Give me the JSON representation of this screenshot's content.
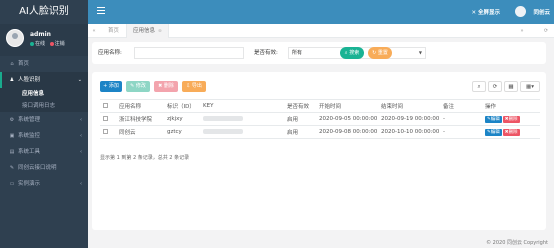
{
  "brand": "AI人脸识别",
  "user": {
    "name": "admin",
    "online": "在线",
    "logout": "注销"
  },
  "nav": [
    {
      "label": "首页",
      "icon": "home-icon",
      "glyph": "⌂"
    },
    {
      "label": "人脸识别",
      "icon": "user-icon",
      "glyph": "♟",
      "open": true,
      "children": [
        {
          "label": "应用信息",
          "active": true
        },
        {
          "label": "接口调用日志"
        }
      ]
    },
    {
      "label": "系统管理",
      "icon": "gear-icon",
      "glyph": "⚙"
    },
    {
      "label": "系统监控",
      "icon": "monitor-icon",
      "glyph": "▣"
    },
    {
      "label": "系统工具",
      "icon": "tools-icon",
      "glyph": "▤"
    },
    {
      "label": "同创云接口说明",
      "icon": "doc-icon",
      "glyph": "✎"
    },
    {
      "label": "实例演示",
      "icon": "desktop-icon",
      "glyph": "▭"
    }
  ],
  "topbar": {
    "fullscreen": "全屏显示",
    "username": "同创云"
  },
  "tabs": {
    "home": "首页",
    "current": "应用信息"
  },
  "search": {
    "app_name_label": "应用名称:",
    "app_name_value": "",
    "valid_label": "是否有效:",
    "valid_value": "所有",
    "search_btn": "搜索",
    "reset_btn": "重置"
  },
  "toolbar": {
    "add": "添加",
    "edit": "修改",
    "delete": "删除",
    "export": "导出"
  },
  "table": {
    "headers": [
      "应用名称",
      "标识（ID）",
      "KEY",
      "是否有效",
      "开始时间",
      "结束时间",
      "备注",
      "操作"
    ],
    "rows": [
      {
        "name": "浙江科技学院",
        "id": "zjkjxy",
        "valid": "启用",
        "start": "2020-09-05 00:00:00",
        "end": "2020-09-19 00:00:00",
        "note": "-"
      },
      {
        "name": "同创云",
        "id": "gztcy",
        "valid": "启用",
        "start": "2020-09-08 00:00:00",
        "end": "2020-10-10 00:00:00",
        "note": "-"
      }
    ],
    "edit_label": "编辑",
    "delete_label": "删除",
    "summary": "显示第 1 到第 2 条记录，总共 2 条记录"
  },
  "footer": "© 2020 同创云 Copyright",
  "colors": {
    "sidebar": "#2f4050",
    "topbar": "#3c8dbc",
    "accent": "#1ab394",
    "primary": "#1c84c6",
    "warning": "#f8ac59",
    "danger": "#ed5565"
  }
}
